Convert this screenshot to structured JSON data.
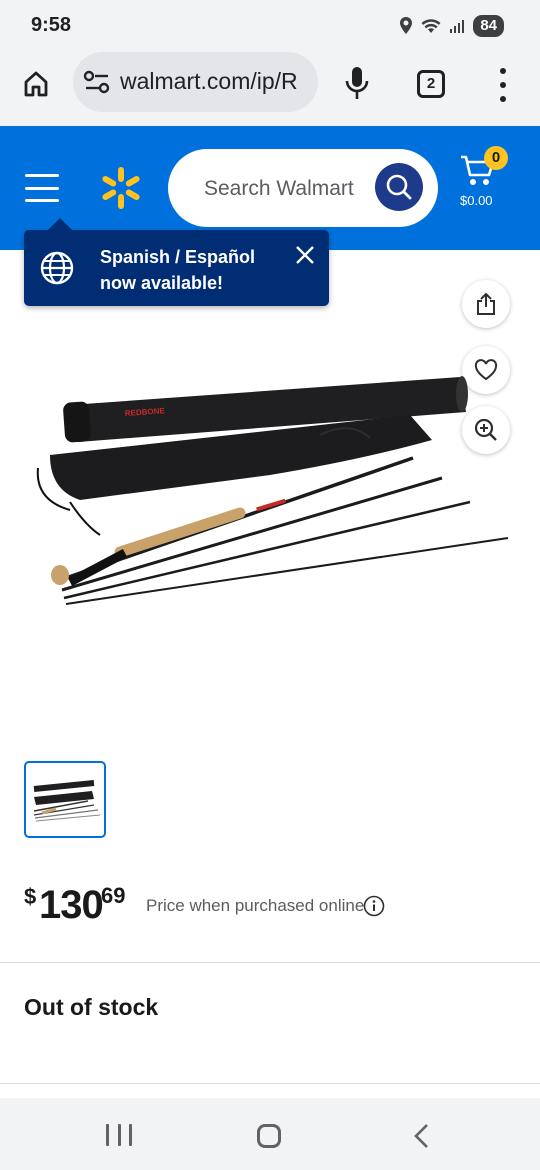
{
  "status_bar": {
    "time": "9:58",
    "battery": "84"
  },
  "browser": {
    "url": "walmart.com/ip/R",
    "tab_count": "2"
  },
  "header": {
    "search_placeholder": "Search Walmart",
    "cart_count": "0",
    "cart_total": "$0.00",
    "brand_color": "#0071dc",
    "spark_color": "#ffc220"
  },
  "lang_popup": {
    "line1": "Spanish / Español",
    "line2": "now available!"
  },
  "product": {
    "image_alt": "fly fishing rod with tube case",
    "case_label": "REDBONE"
  },
  "price": {
    "currency": "$",
    "dollars": "130",
    "cents": "69",
    "note": "Price when purchased online"
  },
  "availability": {
    "status": "Out of stock"
  }
}
